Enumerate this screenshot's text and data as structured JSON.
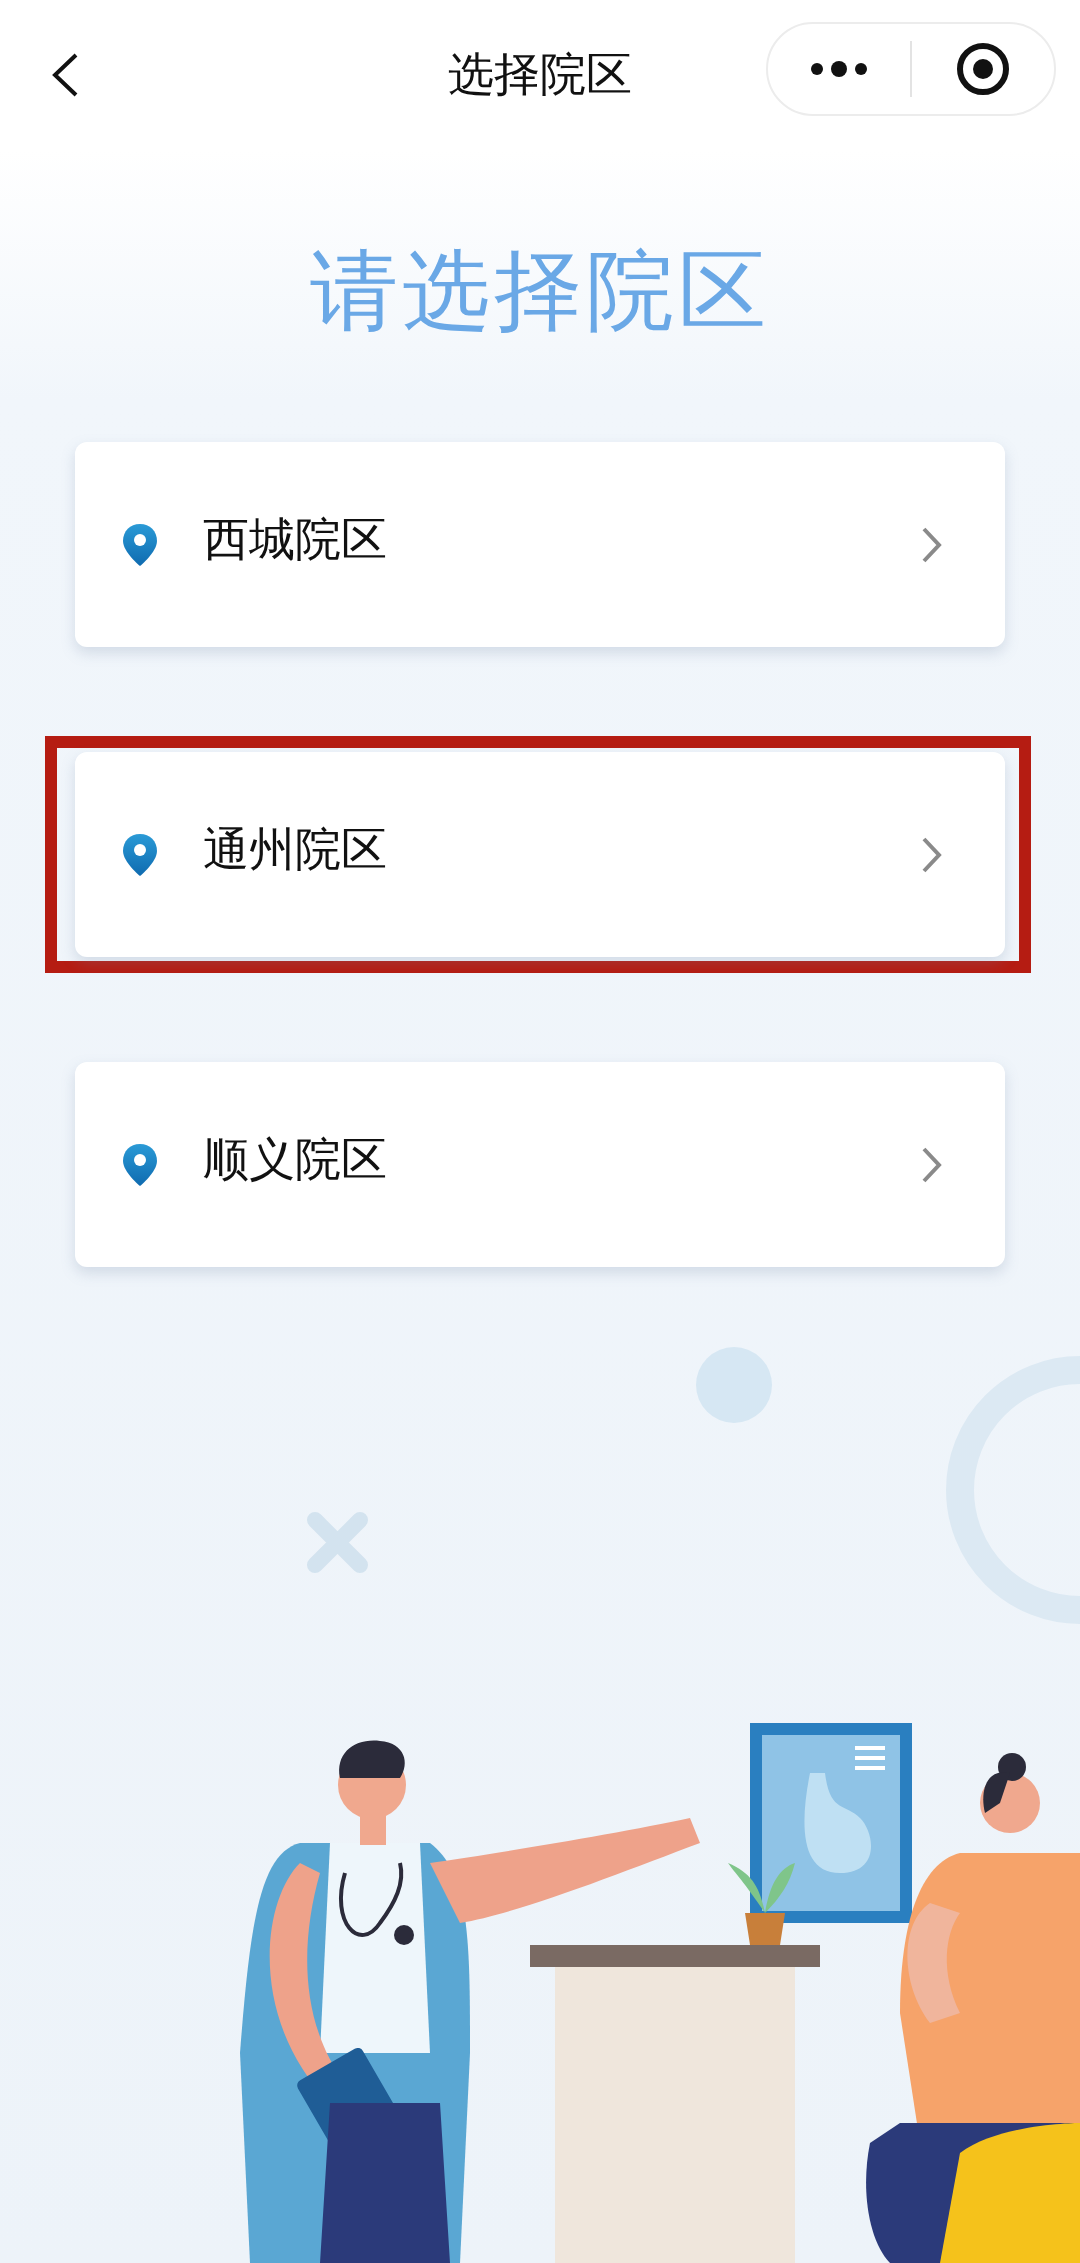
{
  "nav_bar": {
    "title": "选择院区"
  },
  "heading": "请选择院区",
  "campuses": [
    {
      "name": "西城院区",
      "highlighted": false
    },
    {
      "name": "通州院区",
      "highlighted": true
    },
    {
      "name": "顺义院区",
      "highlighted": false
    }
  ]
}
